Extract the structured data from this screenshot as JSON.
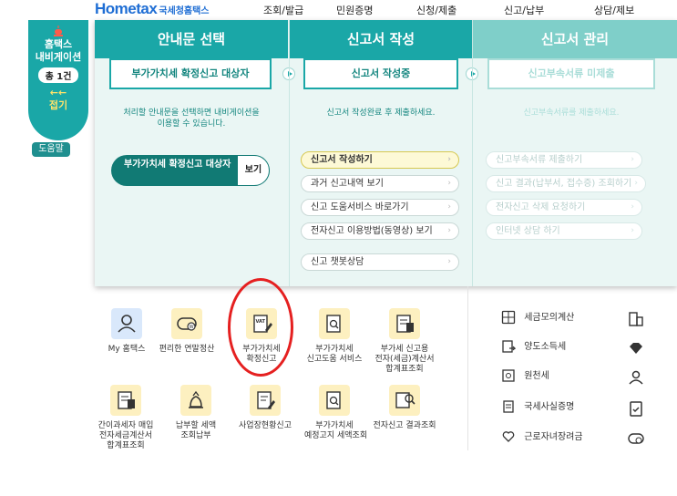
{
  "nav": {
    "logo_main": "Hometax",
    "logo_sub": "국세청홈택스",
    "items": [
      "조회/발급",
      "민원증명",
      "신청/제출",
      "신고/납부",
      "상담/제보"
    ]
  },
  "sidebar": {
    "title_line1": "홈택스",
    "title_line2": "내비게이션",
    "count": "총 1건",
    "arrow": "←←",
    "close": "접기",
    "help": "도움말"
  },
  "panel": {
    "col1": {
      "header": "안내문 선택",
      "step": "부가가치세 확정신고 대상자",
      "desc_line1": "처리할 안내문을 선택하면 내비게이션을",
      "desc_line2": "이용할 수 있습니다.",
      "guide_text": "부가가치세 확정신고 대상자",
      "guide_view": "보기"
    },
    "col2": {
      "header": "신고서 작성",
      "step": "신고서 작성중",
      "desc": "신고서 작성완료 후 제출하세요.",
      "menu": [
        {
          "label": "신고서 작성하기"
        },
        {
          "label": "과거 신고내역 보기"
        },
        {
          "label": "신고 도움서비스 바로가기"
        },
        {
          "label": "전자신고 이용방법(동영상) 보기"
        },
        {
          "label": "신고 챗봇상담"
        }
      ]
    },
    "col3": {
      "header": "신고서 관리",
      "step": "신고부속서류 미제출",
      "desc": "신고부속서류를 제출하세요.",
      "menu": [
        {
          "label": "신고부속서류 제출하기"
        },
        {
          "label": "신고 결과(납부서, 접수증) 조회하기"
        },
        {
          "label": "전자신고 삭제 요청하기"
        },
        {
          "label": "인터넷 상담 하기"
        }
      ]
    }
  },
  "tiles": {
    "row1": [
      {
        "line1": "My 홈택스",
        "line2": "",
        "line3": ""
      },
      {
        "line1": "편리한 연말정산",
        "line2": "",
        "line3": ""
      },
      {
        "line1": "부가가치세",
        "line2": "확정신고",
        "line3": ""
      },
      {
        "line1": "부가가치세",
        "line2": "신고도움 서비스",
        "line3": ""
      },
      {
        "line1": "부가세 신고용",
        "line2": "전자(세금)계산서",
        "line3": "합계표조회"
      }
    ],
    "row2": [
      {
        "line1": "간이과세자 매입",
        "line2": "전자세금계산서",
        "line3": "합계표조회"
      },
      {
        "line1": "납부할 세액",
        "line2": "조회납부",
        "line3": ""
      },
      {
        "line1": "사업장현황신고",
        "line2": "",
        "line3": ""
      },
      {
        "line1": "부가가치세",
        "line2": "예정고지 세액조회",
        "line3": ""
      },
      {
        "line1": "전자신고 결과조회",
        "line2": "",
        "line3": ""
      }
    ]
  },
  "right_list": [
    {
      "label": "세금모의계산"
    },
    {
      "label": "양도소득세"
    },
    {
      "label": "원천세"
    },
    {
      "label": "국세사실증명"
    },
    {
      "label": "근로자녀장려금"
    }
  ]
}
